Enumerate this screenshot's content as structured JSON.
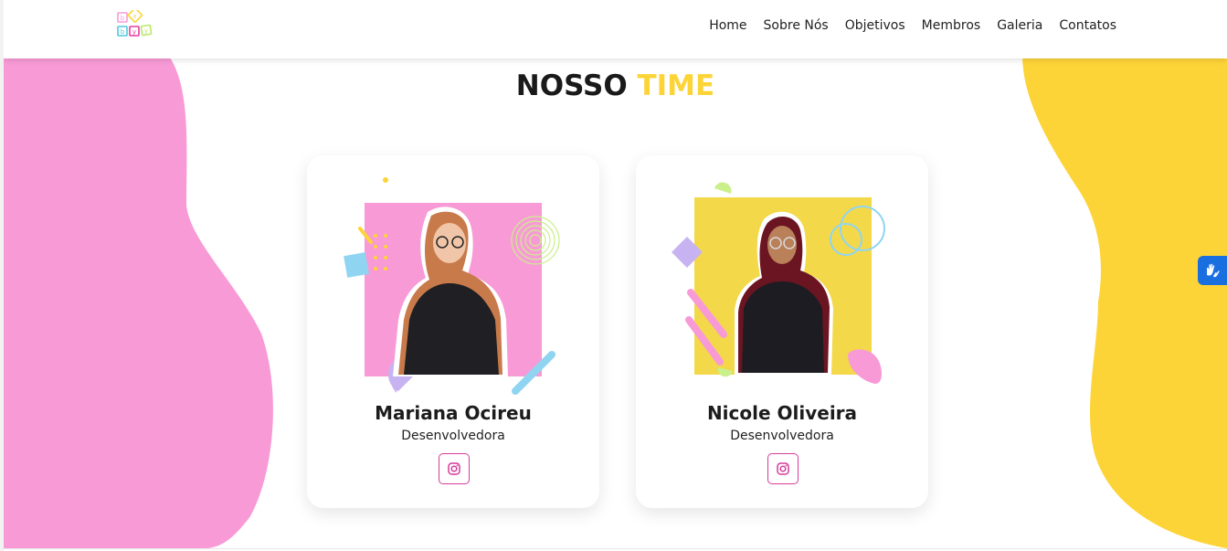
{
  "app": {
    "logo_icon": "baby-blocks-logo-icon"
  },
  "nav": {
    "items": [
      {
        "label": "Home"
      },
      {
        "label": "Sobre Nós"
      },
      {
        "label": "Objetivos"
      },
      {
        "label": "Membros"
      },
      {
        "label": "Galeria"
      },
      {
        "label": "Contatos"
      }
    ]
  },
  "section": {
    "title_main": "NOSSO",
    "title_accent": "TIME"
  },
  "members": [
    {
      "name": "Mariana Ocireu",
      "role": "Desenvolvedora",
      "social_icon": "instagram-icon"
    },
    {
      "name": "Nicole Oliveira",
      "role": "Desenvolvedora",
      "social_icon": "instagram-icon"
    }
  ],
  "accessibility": {
    "icon": "sign-language-hands-icon"
  },
  "colors": {
    "pink": "#f89ad6",
    "yellow": "#fdd437",
    "instagram_accent": "#d63a9a",
    "a11y_blue": "#1a6fe0"
  }
}
